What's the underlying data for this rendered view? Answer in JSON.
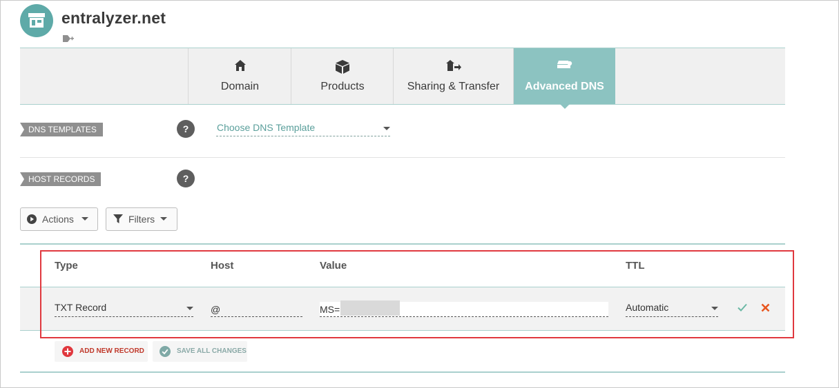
{
  "site": {
    "title": "entralyzer.net",
    "avatar_icon": "storefront-icon",
    "tag_icon": "add-tag-icon",
    "accent_color": "#5eaaa8"
  },
  "nav": {
    "tabs": [
      {
        "label": "Domain",
        "icon": "home-icon",
        "active": false
      },
      {
        "label": "Products",
        "icon": "box-icon",
        "active": false
      },
      {
        "label": "Sharing & Transfer",
        "icon": "transfer-icon",
        "active": false
      },
      {
        "label": "Advanced DNS",
        "icon": "dns-server-icon",
        "active": true
      }
    ],
    "active_color": "#8cc3c1"
  },
  "dns_templates": {
    "section_label": "DNS TEMPLATES",
    "help_label": "?",
    "select_placeholder": "Choose DNS Template"
  },
  "host_records": {
    "section_label": "HOST RECORDS",
    "help_label": "?",
    "actions_label": "Actions",
    "filters_label": "Filters",
    "columns": {
      "type": "Type",
      "host": "Host",
      "value": "Value",
      "ttl": "TTL"
    },
    "record": {
      "type": "TXT Record",
      "host": "@",
      "value": "MS=",
      "ttl": "Automatic"
    },
    "add_new_record_label": "ADD NEW RECORD",
    "save_all_changes_label": "SAVE ALL CHANGES"
  },
  "colors": {
    "confirm": "#6bb8a5",
    "cancel": "#e8561f",
    "add": "#e0383e",
    "highlight": "#e0383e"
  }
}
